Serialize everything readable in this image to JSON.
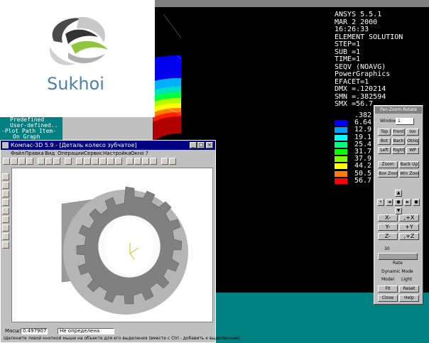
{
  "logo": {
    "text": "Sukhoi"
  },
  "ansys": {
    "readout": [
      "ANSYS 5.5.1",
      "MAR  2 2000",
      "16:26:33",
      "ELEMENT SOLUTION",
      "STEP=1",
      "SUB =1",
      "TIME=1",
      "SEQV     (NOAVG)",
      "PowerGraphics",
      "EFACET=1",
      "DMX =.120214",
      "SMN =.382594",
      "SMX =56.7"
    ],
    "legend": [
      {
        "value": ".382",
        "color": "#000000"
      },
      {
        "value": "6.64",
        "color": "#0000ff"
      },
      {
        "value": "12.9",
        "color": "#00a0ff"
      },
      {
        "value": "19.1",
        "color": "#00ffff"
      },
      {
        "value": "25.4",
        "color": "#00ff80"
      },
      {
        "value": "31.7",
        "color": "#00ff00"
      },
      {
        "value": "37.9",
        "color": "#80ff00"
      },
      {
        "value": "44.2",
        "color": "#ffff00"
      },
      {
        "value": "50.5",
        "color": "#ff8000"
      },
      {
        "value": "56.7",
        "color": "#ff0000"
      }
    ],
    "menu_lines": [
      "Predefined",
      "User-defined..",
      "-Plot Path Item-",
      "On Graph"
    ]
  },
  "kompas": {
    "title": "Компас-3D 5.9 - [Деталь колесо зубчатое]",
    "menu": [
      "Файл",
      "Правка",
      "Вид",
      "Операции",
      "Сервис",
      "Настройка",
      "Окно",
      "?"
    ],
    "scale_label": "Масштаб",
    "scale_value": "0.497907",
    "combo_value": "Не определена",
    "status_hint": "Щелкните левой кнопкой мыши на объекте для его выделения (вместе с Ctrl - добавить к выделенным)"
  },
  "pzr": {
    "title": "Pan-Zoom-Rotate",
    "window_label": "Window",
    "window_value": "1",
    "views": [
      "Top",
      "Front",
      "Iso",
      "Bot",
      "Back",
      "Obliq",
      "Left",
      "Right",
      "WP"
    ],
    "zoom_buttons": [
      "Zoom",
      "Back Up",
      "Box Zoom",
      "Win Zoom"
    ],
    "rot_buttons": [
      "X-",
      ",+X",
      "Y-",
      "+Y",
      "Z-",
      ",+Z"
    ],
    "rate_value": "30",
    "rate_label": "Rate",
    "dynamic_label": "Dynamic Mode",
    "model_label": "Model",
    "light_label": "Light",
    "action_buttons": [
      "Fit",
      "Reset",
      "Close",
      "Help"
    ]
  },
  "colors": {
    "ansys_bg": "#000000",
    "teal": "#008080",
    "kompas_title": "#000080"
  }
}
